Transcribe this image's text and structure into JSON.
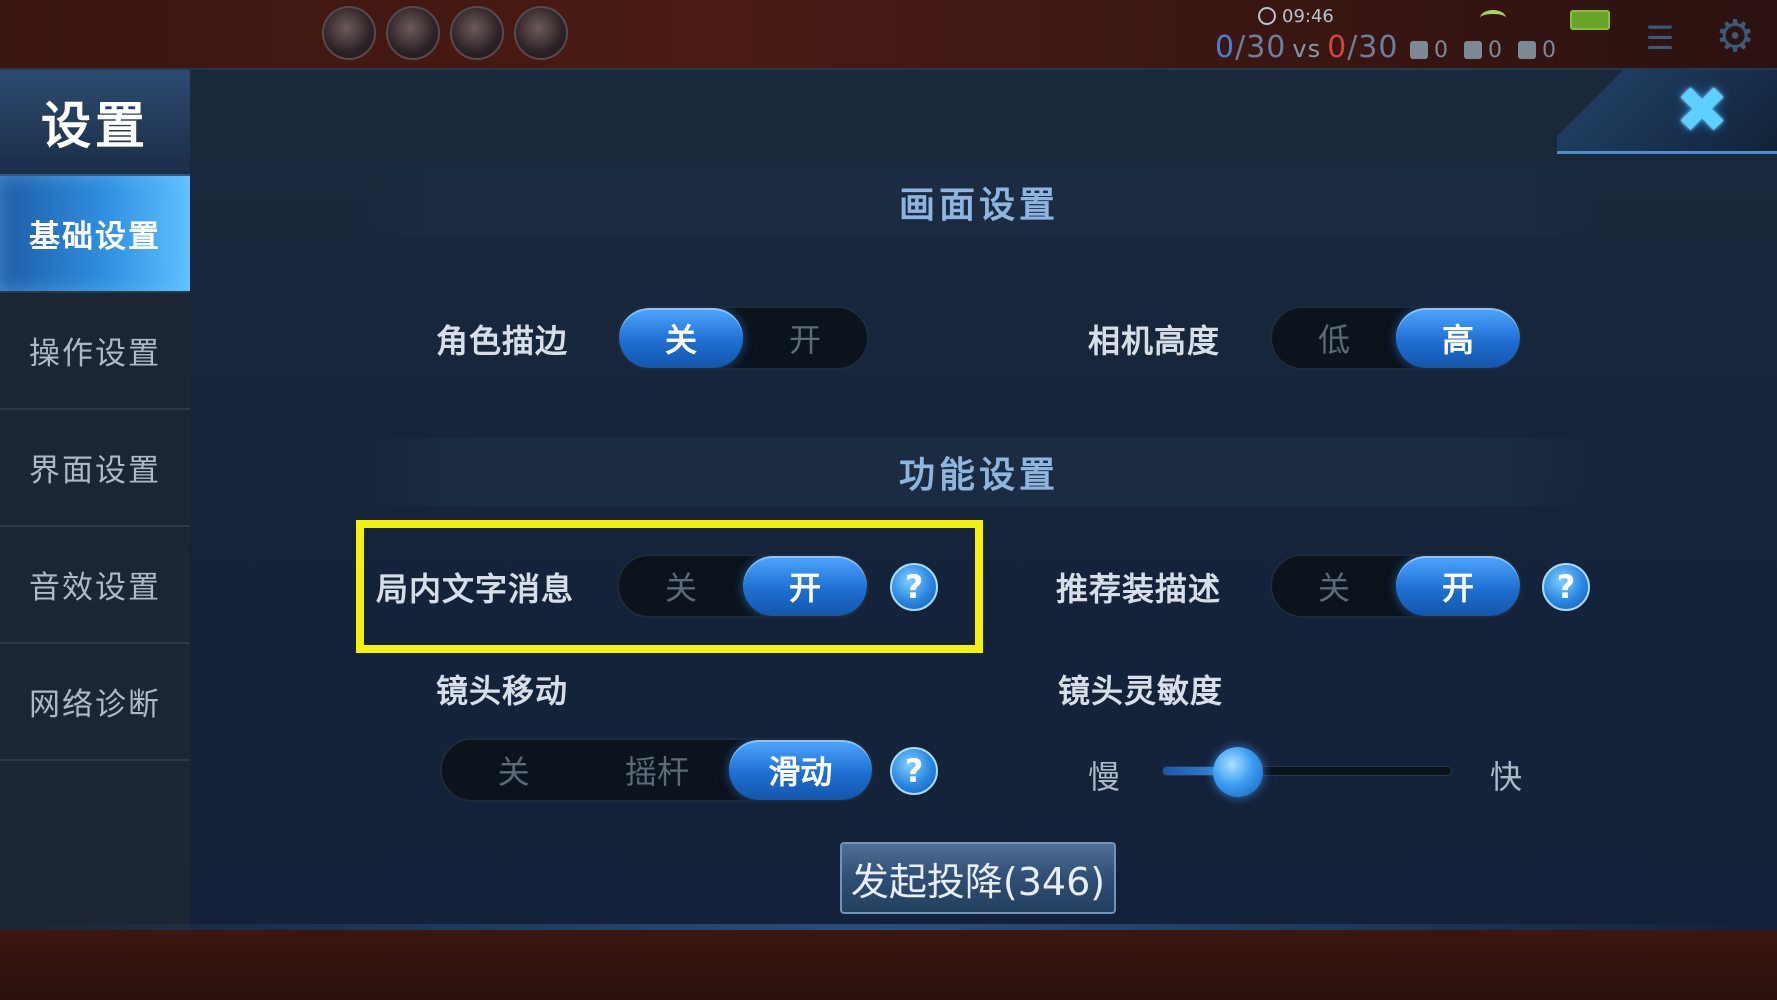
{
  "hud": {
    "time": "09:46",
    "score_left": "0",
    "score_left_total": "/30",
    "vs": "vs",
    "score_right": "0",
    "score_right_total": "/30",
    "kills": "0",
    "deaths": "0",
    "assists": "0"
  },
  "sidebar": {
    "title": "设置",
    "items": [
      {
        "label": "基础设置",
        "active": true
      },
      {
        "label": "操作设置"
      },
      {
        "label": "界面设置"
      },
      {
        "label": "音效设置"
      },
      {
        "label": "网络诊断"
      }
    ]
  },
  "sections": {
    "display": "画面设置",
    "function": "功能设置"
  },
  "settings": {
    "outline": {
      "label": "角色描边",
      "off": "关",
      "on": "开",
      "selected": "关"
    },
    "camera_height": {
      "label": "相机高度",
      "low": "低",
      "high": "高",
      "selected": "高"
    },
    "in_game_text": {
      "label": "局内文字消息",
      "off": "关",
      "on": "开",
      "selected": "开"
    },
    "recommend_desc": {
      "label": "推荐装描述",
      "off": "关",
      "on": "开",
      "selected": "开"
    },
    "lens_move": {
      "label": "镜头移动",
      "off": "关",
      "joystick": "摇杆",
      "slide": "滑动",
      "selected": "滑动"
    },
    "lens_sensitivity": {
      "label": "镜头灵敏度",
      "slow": "慢",
      "fast": "快",
      "value": 0.26
    }
  },
  "help_glyph": "?",
  "close_glyph": "✖",
  "surrender_label": "发起投降(346)",
  "colors": {
    "accent": "#2f8fe0",
    "highlight": "#f2f20e",
    "close": "#5ed0ff"
  }
}
